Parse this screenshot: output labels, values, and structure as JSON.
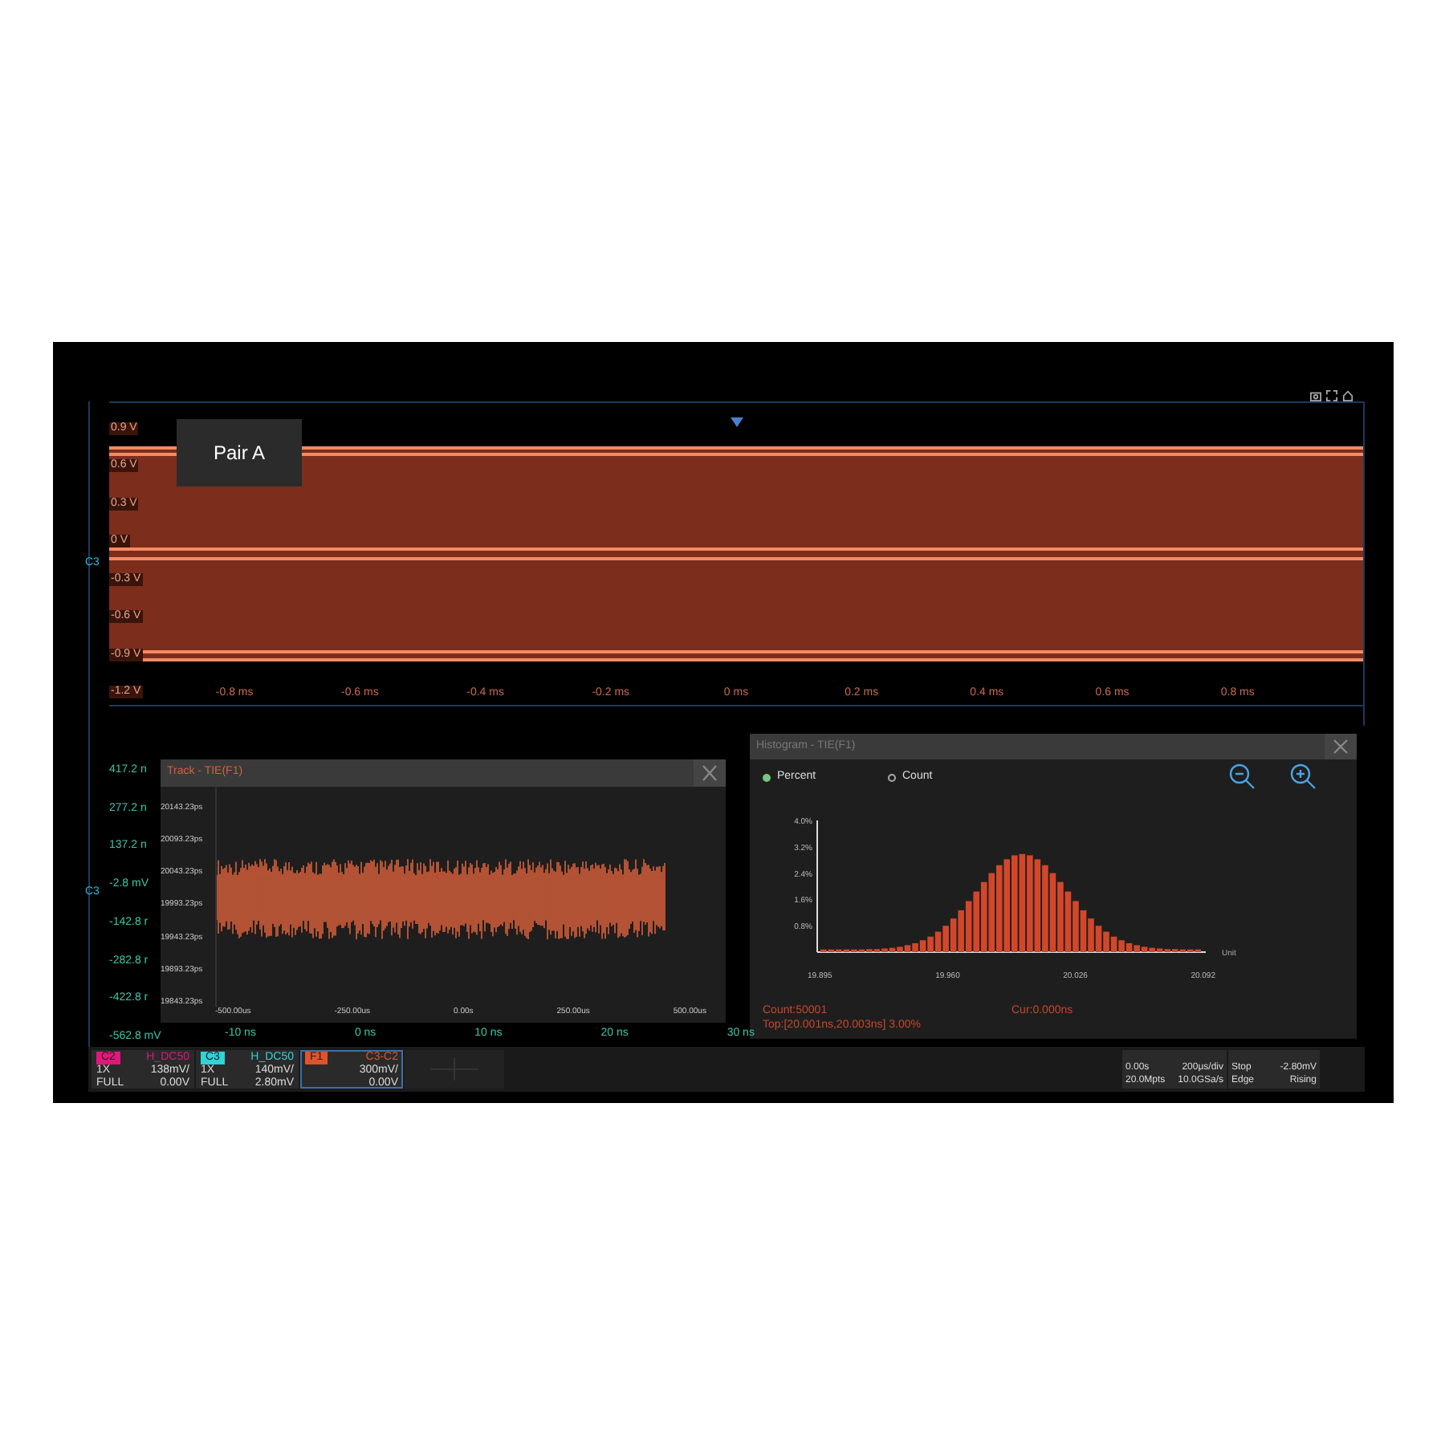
{
  "top_panel": {
    "label": "Pair A",
    "channel_marker": "C3",
    "y_labels": [
      "0.9 V",
      "0.6 V",
      "0.3 V",
      "0 V",
      "-0.3 V",
      "-0.6 V",
      "-0.9 V",
      "-1.2 V"
    ],
    "x_labels": [
      "-0.8 ms",
      "-0.6 ms",
      "-0.4 ms",
      "-0.2 ms",
      "0 ms",
      "0.2 ms",
      "0.4 ms",
      "0.6 ms",
      "0.8 ms"
    ]
  },
  "zoom_panel": {
    "channel_marker": "C3",
    "y_labels": [
      "417.2 n",
      "277.2 n",
      "137.2 n",
      "-2.8 mV",
      "-142.8 r",
      "-282.8 r",
      "-422.8 r",
      "-562.8 mV"
    ],
    "x_labels": [
      "-10 ns",
      "0 ns",
      "10 ns",
      "20 ns",
      "30 ns"
    ]
  },
  "track_window": {
    "title": "Track - TIE(F1)",
    "y_labels": [
      "20143.23ps",
      "20093.23ps",
      "20043.23ps",
      "19993.23ps",
      "19943.23ps",
      "19893.23ps",
      "19843.23ps"
    ],
    "x_labels": [
      "-500.00us",
      "-250.00us",
      "0.00s",
      "250.00us",
      "500.00us"
    ]
  },
  "histogram_window": {
    "title": "Histogram - TIE(F1)",
    "options": [
      {
        "label": "Percent",
        "selected": true
      },
      {
        "label": "Count",
        "selected": false
      }
    ],
    "unit": "Unit",
    "x_axis_labels": [
      "19.895",
      "19.960",
      "20.026",
      "20.092"
    ],
    "chart_data": {
      "type": "bar",
      "ylim": [
        0,
        4.0
      ],
      "yticks": [
        {
          "value": 0.8,
          "label": "0.8%"
        },
        {
          "value": 1.6,
          "label": "1.6%"
        },
        {
          "value": 2.4,
          "label": "2.4%"
        },
        {
          "value": 3.2,
          "label": "3.2%"
        },
        {
          "value": 4.0,
          "label": "4.0%"
        }
      ],
      "values": [
        0.08,
        0.08,
        0.08,
        0.08,
        0.08,
        0.08,
        0.09,
        0.09,
        0.11,
        0.13,
        0.16,
        0.21,
        0.27,
        0.36,
        0.47,
        0.62,
        0.8,
        1.02,
        1.27,
        1.55,
        1.84,
        2.13,
        2.4,
        2.64,
        2.82,
        2.94,
        2.98,
        2.94,
        2.82,
        2.64,
        2.4,
        2.13,
        1.84,
        1.55,
        1.27,
        1.02,
        0.8,
        0.62,
        0.47,
        0.36,
        0.27,
        0.21,
        0.16,
        0.13,
        0.11,
        0.09,
        0.09,
        0.08,
        0.08,
        0.08
      ]
    },
    "count": "Count:50001",
    "cursor": "Cur:0.000ns",
    "top": "Top:[20.001ns,20.003ns] 3.00%"
  },
  "channels": [
    {
      "name": "C2",
      "color": "#e3167c",
      "source": "H_DC50",
      "probe": "1X",
      "scale": "138mV/",
      "bandwidth": "FULL",
      "offset": "0.00V",
      "selected": false
    },
    {
      "name": "C3",
      "color": "#2fd3d8",
      "source": "H_DC50",
      "probe": "1X",
      "scale": "140mV/",
      "bandwidth": "FULL",
      "offset": "2.80mV",
      "selected": false
    },
    {
      "name": "F1",
      "color": "#e0532a",
      "source": "C3-C2",
      "scale": "300mV/",
      "offset": "0.00V",
      "selected": true
    }
  ],
  "timebase": {
    "delay": "0.00s",
    "scale": "200μs/div",
    "memory": "20.0Mpts",
    "sample_rate": "10.0GSa/s"
  },
  "trigger": {
    "state": "Stop",
    "level": "-2.80mV",
    "type": "Edge",
    "slope": "Rising"
  }
}
